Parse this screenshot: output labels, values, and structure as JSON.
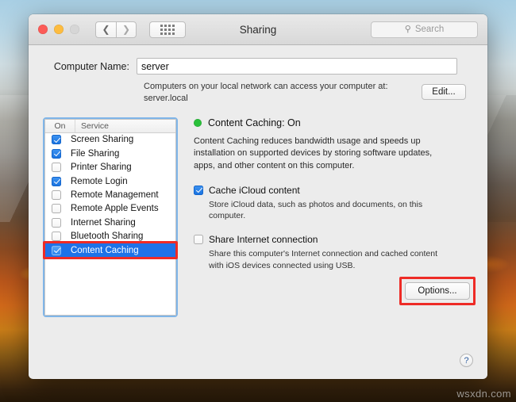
{
  "window": {
    "title": "Sharing",
    "traffic_lights": [
      "close",
      "minimize",
      "zoom"
    ],
    "back_icon": "chevron-left-icon",
    "forward_icon": "chevron-right-icon",
    "grid_icon": "show-all-grid-icon"
  },
  "search": {
    "placeholder": "Search",
    "icon": "search-icon",
    "value": ""
  },
  "computer_name": {
    "label": "Computer Name:",
    "value": "server",
    "placeholder": "Computer Name",
    "note_line1": "Computers on your local network can access your computer at:",
    "note_line2": "server.local",
    "edit_label": "Edit..."
  },
  "service_list": {
    "columns": {
      "on": "On",
      "service": "Service"
    },
    "rows": [
      {
        "label": "Screen Sharing",
        "checked": true,
        "selected": false
      },
      {
        "label": "File Sharing",
        "checked": true,
        "selected": false
      },
      {
        "label": "Printer Sharing",
        "checked": false,
        "selected": false
      },
      {
        "label": "Remote Login",
        "checked": true,
        "selected": false
      },
      {
        "label": "Remote Management",
        "checked": false,
        "selected": false
      },
      {
        "label": "Remote Apple Events",
        "checked": false,
        "selected": false
      },
      {
        "label": "Internet Sharing",
        "checked": false,
        "selected": false
      },
      {
        "label": "Bluetooth Sharing",
        "checked": false,
        "selected": false
      },
      {
        "label": "Content Caching",
        "checked": true,
        "selected": true
      }
    ]
  },
  "detail": {
    "status": "Content Caching: On",
    "status_dot_color": "#29c03a",
    "description": "Content Caching reduces bandwidth usage and speeds up installation on supported devices by storing software updates, apps, and other content on this computer.",
    "options": [
      {
        "label": "Cache iCloud content",
        "checked": true,
        "sub": "Store iCloud data, such as photos and documents, on this computer."
      },
      {
        "label": "Share Internet connection",
        "checked": false,
        "sub": "Share this computer's Internet connection and cached content with iOS devices connected using USB."
      }
    ],
    "options_button": "Options..."
  },
  "help": {
    "glyph": "?"
  },
  "annotations": {
    "highlight_color": "#ee2b26",
    "boxes": [
      "content-caching-row",
      "options-button"
    ]
  },
  "watermark": {
    "text": "wsxdn.com"
  }
}
